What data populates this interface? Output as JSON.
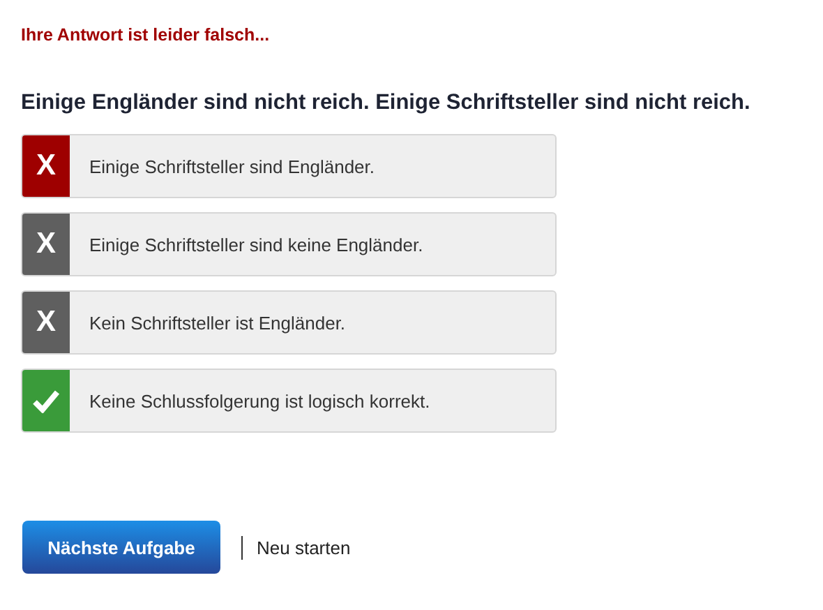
{
  "feedback": "Ihre Antwort ist leider falsch...",
  "question": "Einige Engländer sind nicht reich. Einige Schriftsteller sind nicht reich.",
  "options": [
    {
      "kind": "wrong",
      "mark": "X",
      "selected": true,
      "label": "Einige Schriftsteller sind Engländer."
    },
    {
      "kind": "wrong",
      "mark": "X",
      "selected": false,
      "label": "Einige Schriftsteller sind keine Engländer."
    },
    {
      "kind": "wrong",
      "mark": "X",
      "selected": false,
      "label": "Kein Schriftsteller ist Engländer."
    },
    {
      "kind": "correct",
      "selected": false,
      "label": "Keine Schlussfolgerung ist logisch korrekt."
    }
  ],
  "next_button": "Nächste Aufgabe",
  "restart_link": "Neu starten"
}
